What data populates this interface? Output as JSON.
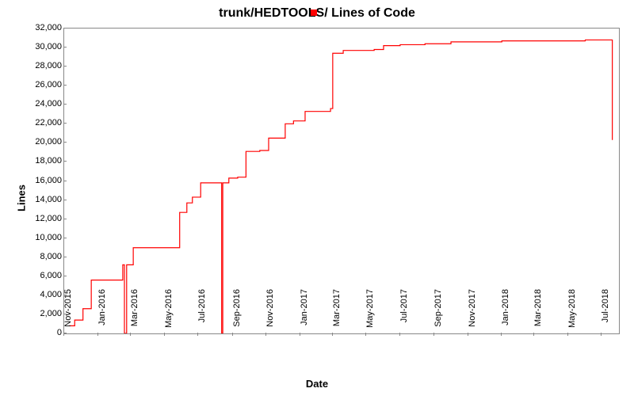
{
  "chart_data": {
    "type": "line",
    "title": "trunk/HEDTOOLS/ Lines of Code",
    "xlabel": "Date",
    "ylabel": "Lines",
    "ylim": [
      0,
      32000
    ],
    "y_ticks": [
      0,
      2000,
      4000,
      6000,
      8000,
      10000,
      12000,
      14000,
      16000,
      18000,
      20000,
      22000,
      24000,
      26000,
      28000,
      30000,
      32000
    ],
    "y_tick_labels": [
      "0",
      "2,000",
      "4,000",
      "6,000",
      "8,000",
      "10,000",
      "12,000",
      "14,000",
      "16,000",
      "18,000",
      "20,000",
      "22,000",
      "24,000",
      "26,000",
      "28,000",
      "30,000",
      "32,000"
    ],
    "x_range": [
      "2015-11-01",
      "2018-08-01"
    ],
    "x_ticks": [
      "2015-11",
      "2016-01",
      "2016-03",
      "2016-05",
      "2016-07",
      "2016-09",
      "2016-11",
      "2017-01",
      "2017-03",
      "2017-05",
      "2017-07",
      "2017-09",
      "2017-11",
      "2018-01",
      "2018-03",
      "2018-05",
      "2018-07"
    ],
    "x_tick_labels": [
      "Nov-2015",
      "Jan-2016",
      "Mar-2016",
      "May-2016",
      "Jul-2016",
      "Sep-2016",
      "Nov-2016",
      "Jan-2017",
      "Mar-2017",
      "May-2017",
      "Jul-2017",
      "Sep-2017",
      "Nov-2017",
      "Jan-2018",
      "Mar-2018",
      "May-2018",
      "Jul-2018"
    ],
    "series": [
      {
        "name": "trunk/HEDTOOLS/",
        "color": "#ff0000",
        "step": true,
        "points": [
          {
            "x": "2015-11-10",
            "y": 800
          },
          {
            "x": "2015-11-20",
            "y": 1400
          },
          {
            "x": "2015-12-05",
            "y": 2600
          },
          {
            "x": "2015-12-20",
            "y": 5600
          },
          {
            "x": "2016-02-10",
            "y": 5600
          },
          {
            "x": "2016-02-15",
            "y": 7200
          },
          {
            "x": "2016-02-18",
            "y": 0
          },
          {
            "x": "2016-02-22",
            "y": 7200
          },
          {
            "x": "2016-03-05",
            "y": 9000
          },
          {
            "x": "2016-05-20",
            "y": 9000
          },
          {
            "x": "2016-05-28",
            "y": 12700
          },
          {
            "x": "2016-06-10",
            "y": 13700
          },
          {
            "x": "2016-06-20",
            "y": 14300
          },
          {
            "x": "2016-07-05",
            "y": 15800
          },
          {
            "x": "2016-08-10",
            "y": 15800
          },
          {
            "x": "2016-08-12",
            "y": 0
          },
          {
            "x": "2016-08-14",
            "y": 15800
          },
          {
            "x": "2016-08-25",
            "y": 16300
          },
          {
            "x": "2016-09-10",
            "y": 16400
          },
          {
            "x": "2016-09-25",
            "y": 19100
          },
          {
            "x": "2016-10-20",
            "y": 19200
          },
          {
            "x": "2016-11-05",
            "y": 20500
          },
          {
            "x": "2016-11-25",
            "y": 20500
          },
          {
            "x": "2016-12-05",
            "y": 22000
          },
          {
            "x": "2016-12-20",
            "y": 22300
          },
          {
            "x": "2017-01-10",
            "y": 23300
          },
          {
            "x": "2017-02-25",
            "y": 23600
          },
          {
            "x": "2017-03-01",
            "y": 29400
          },
          {
            "x": "2017-03-20",
            "y": 29700
          },
          {
            "x": "2017-05-15",
            "y": 29800
          },
          {
            "x": "2017-06-01",
            "y": 30200
          },
          {
            "x": "2017-07-01",
            "y": 30300
          },
          {
            "x": "2017-08-15",
            "y": 30400
          },
          {
            "x": "2017-10-01",
            "y": 30600
          },
          {
            "x": "2018-01-01",
            "y": 30700
          },
          {
            "x": "2018-06-01",
            "y": 30800
          },
          {
            "x": "2018-07-15",
            "y": 30800
          },
          {
            "x": "2018-07-20",
            "y": 20300
          }
        ]
      }
    ]
  }
}
